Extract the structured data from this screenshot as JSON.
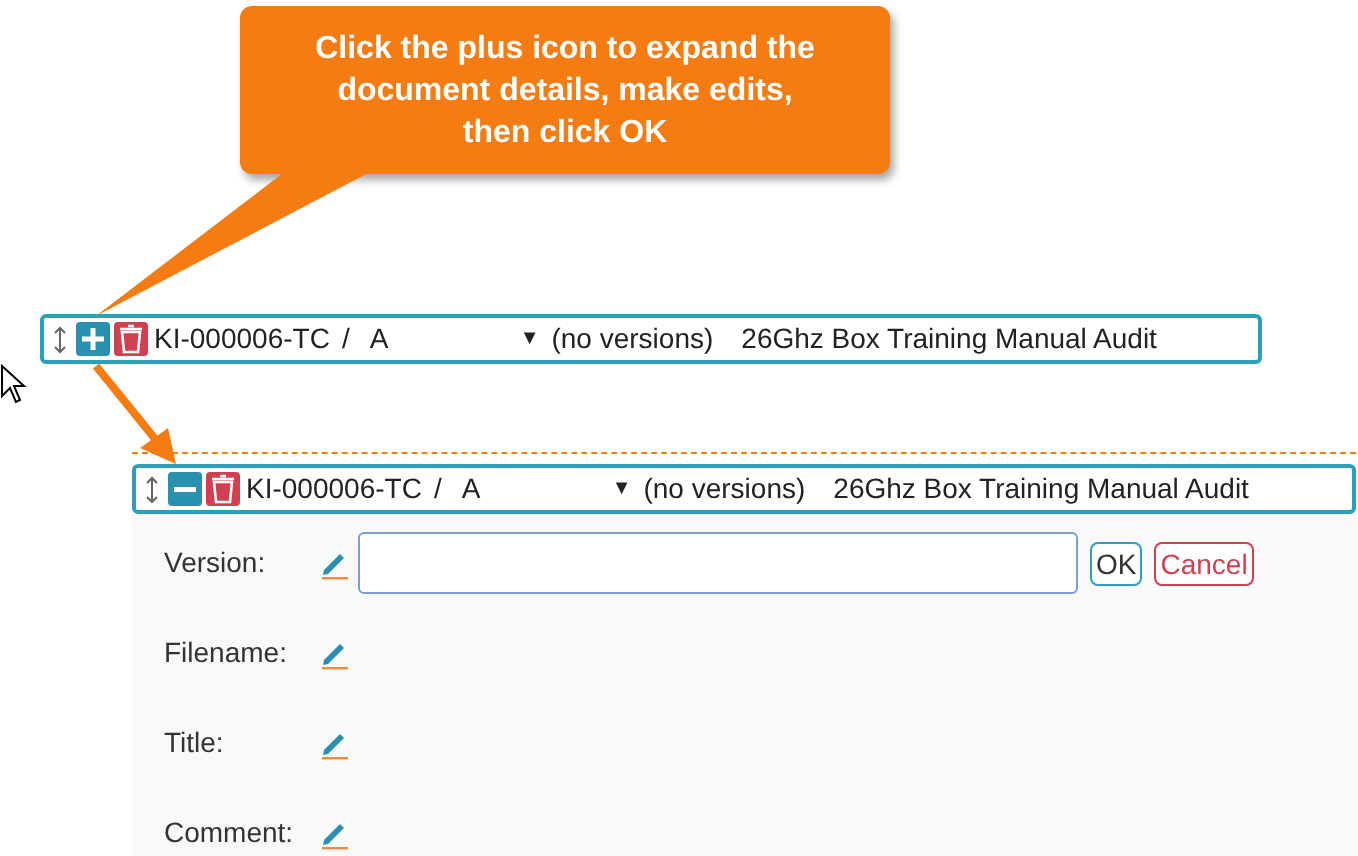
{
  "callout": {
    "text": "Click the plus icon to expand the document details, make edits, then click OK"
  },
  "rows": [
    {
      "expanded": false,
      "code": "KI-000006-TC",
      "separator": "/",
      "revision": "A",
      "caret": "▼",
      "versions": "(no versions)",
      "title": "26Ghz Box Training Manual Audit"
    },
    {
      "expanded": true,
      "code": "KI-000006-TC",
      "separator": "/",
      "revision": "A",
      "caret": "▼",
      "versions": "(no versions)",
      "title": "26Ghz Box Training Manual Audit"
    }
  ],
  "details": {
    "fields": [
      {
        "label": "Version:",
        "kind": "input",
        "buttons": [
          {
            "label": "OK",
            "kind": "ok"
          },
          {
            "label": "Cancel",
            "kind": "cancel"
          }
        ]
      },
      {
        "label": "Filename:",
        "kind": "plain"
      },
      {
        "label": "Title:",
        "kind": "plain"
      },
      {
        "label": "Comment:",
        "kind": "plain"
      }
    ]
  }
}
